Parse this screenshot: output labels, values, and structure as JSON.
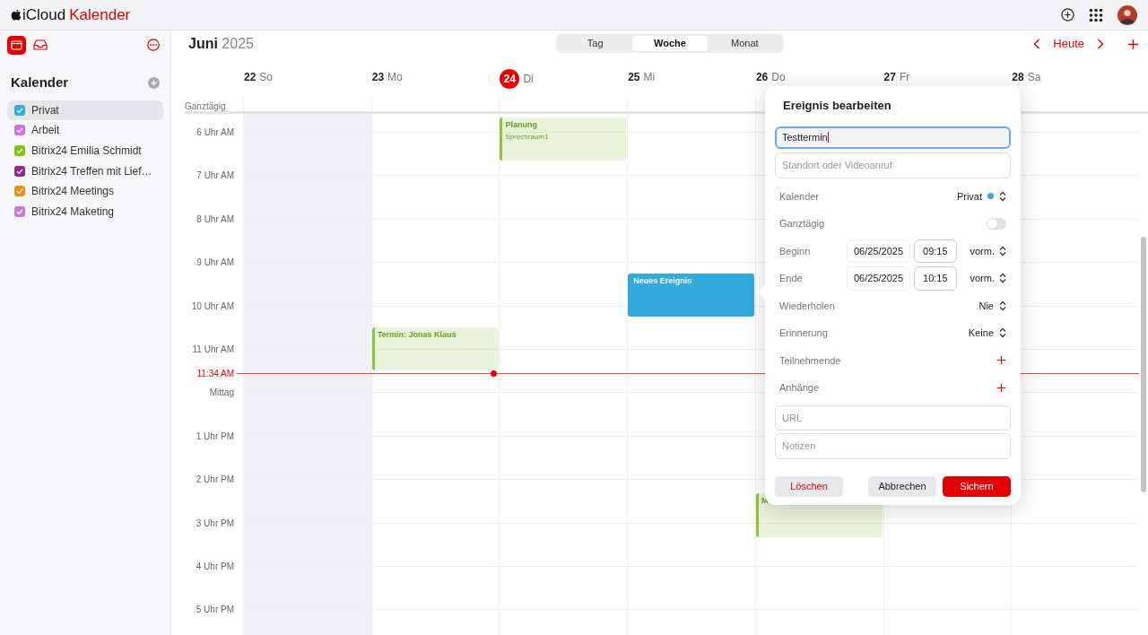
{
  "app": {
    "brand": "iCloud",
    "product": "Kalender"
  },
  "sidebar": {
    "heading": "Kalender",
    "calendars": [
      {
        "name": "Privat",
        "color": "#34aadc",
        "checked": true,
        "selected": true
      },
      {
        "name": "Arbeit",
        "color": "#cc73e1",
        "checked": true,
        "selected": false
      },
      {
        "name": "Bitrix24 Emilia Schmidt",
        "color": "#7ac70c",
        "checked": true,
        "selected": false
      },
      {
        "name": "Bitrix24 Treffen mit Lief…",
        "color": "#8e2a8e",
        "checked": true,
        "selected": false
      },
      {
        "name": "Bitrix24 Meetings",
        "color": "#e3960c",
        "checked": true,
        "selected": false
      },
      {
        "name": "Bitrix24 Maketing",
        "color": "#c67fd6",
        "checked": true,
        "selected": false
      }
    ]
  },
  "toolbar": {
    "month": "Juni",
    "year": "2025",
    "views": [
      {
        "label": "Tag",
        "selected": false
      },
      {
        "label": "Woche",
        "selected": true
      },
      {
        "label": "Monat",
        "selected": false
      }
    ],
    "today": "Heute"
  },
  "days": [
    {
      "number": "22",
      "weekday": "So",
      "today": false,
      "weekend": true
    },
    {
      "number": "23",
      "weekday": "Mo",
      "today": false,
      "weekend": false
    },
    {
      "number": "24",
      "weekday": "Di",
      "today": true,
      "weekend": false
    },
    {
      "number": "25",
      "weekday": "Mi",
      "today": false,
      "weekend": false
    },
    {
      "number": "26",
      "weekday": "Do",
      "today": false,
      "weekend": false
    },
    {
      "number": "27",
      "weekday": "Fr",
      "today": false,
      "weekend": false
    },
    {
      "number": "28",
      "weekday": "Sa",
      "today": false,
      "weekend": false
    }
  ],
  "all_day_label": "Ganztägig",
  "hours": [
    "6 Uhr AM",
    "7 Uhr AM",
    "8 Uhr AM",
    "9 Uhr AM",
    "10 Uhr AM",
    "11 Uhr AM",
    "Mittag",
    "1 Uhr PM",
    "2 Uhr PM",
    "3 Uhr PM",
    "4 Uhr PM",
    "5 Uhr PM"
  ],
  "now": "11:34 AM",
  "events": [
    {
      "title": "Planung",
      "location": "Sprechraum1",
      "color": "#8cc63f",
      "selected": false
    },
    {
      "title": "Termin: Jonas Klaus",
      "color": "#8cc63f",
      "selected": false
    },
    {
      "title": "Neues Ereignis",
      "color": "#34aadc",
      "selected": true
    },
    {
      "title": "M",
      "color": "#8cc63f",
      "selected": false
    }
  ],
  "editor": {
    "title": "Ereignis bearbeiten",
    "name_value": "Testtermin",
    "location_placeholder": "Standort oder Videoanruf",
    "rows": [
      {
        "kind": "select",
        "label": "Kalender",
        "value": "Privat",
        "color": "#34aadc"
      },
      {
        "kind": "toggle",
        "label": "Ganztägig",
        "on": false
      },
      {
        "kind": "datetime",
        "label": "Beginn",
        "date": "06/25/2025",
        "time": "09:15",
        "period": "vorm."
      },
      {
        "kind": "datetime",
        "label": "Ende",
        "date": "06/25/2025",
        "time": "10:15",
        "period": "vorm."
      },
      {
        "kind": "select",
        "label": "Wiederholen",
        "value": "Nie"
      },
      {
        "kind": "select",
        "label": "Erinnerung",
        "value": "Keine"
      },
      {
        "kind": "add",
        "label": "Teilnehmende"
      },
      {
        "kind": "add",
        "label": "Anhänge"
      }
    ],
    "url_placeholder": "URL",
    "notes_placeholder": "Notizen",
    "buttons": [
      {
        "kind": "delete",
        "label": "Löschen"
      },
      {
        "kind": "cancel",
        "label": "Abbrechen"
      },
      {
        "kind": "save",
        "label": "Sichern"
      }
    ]
  }
}
